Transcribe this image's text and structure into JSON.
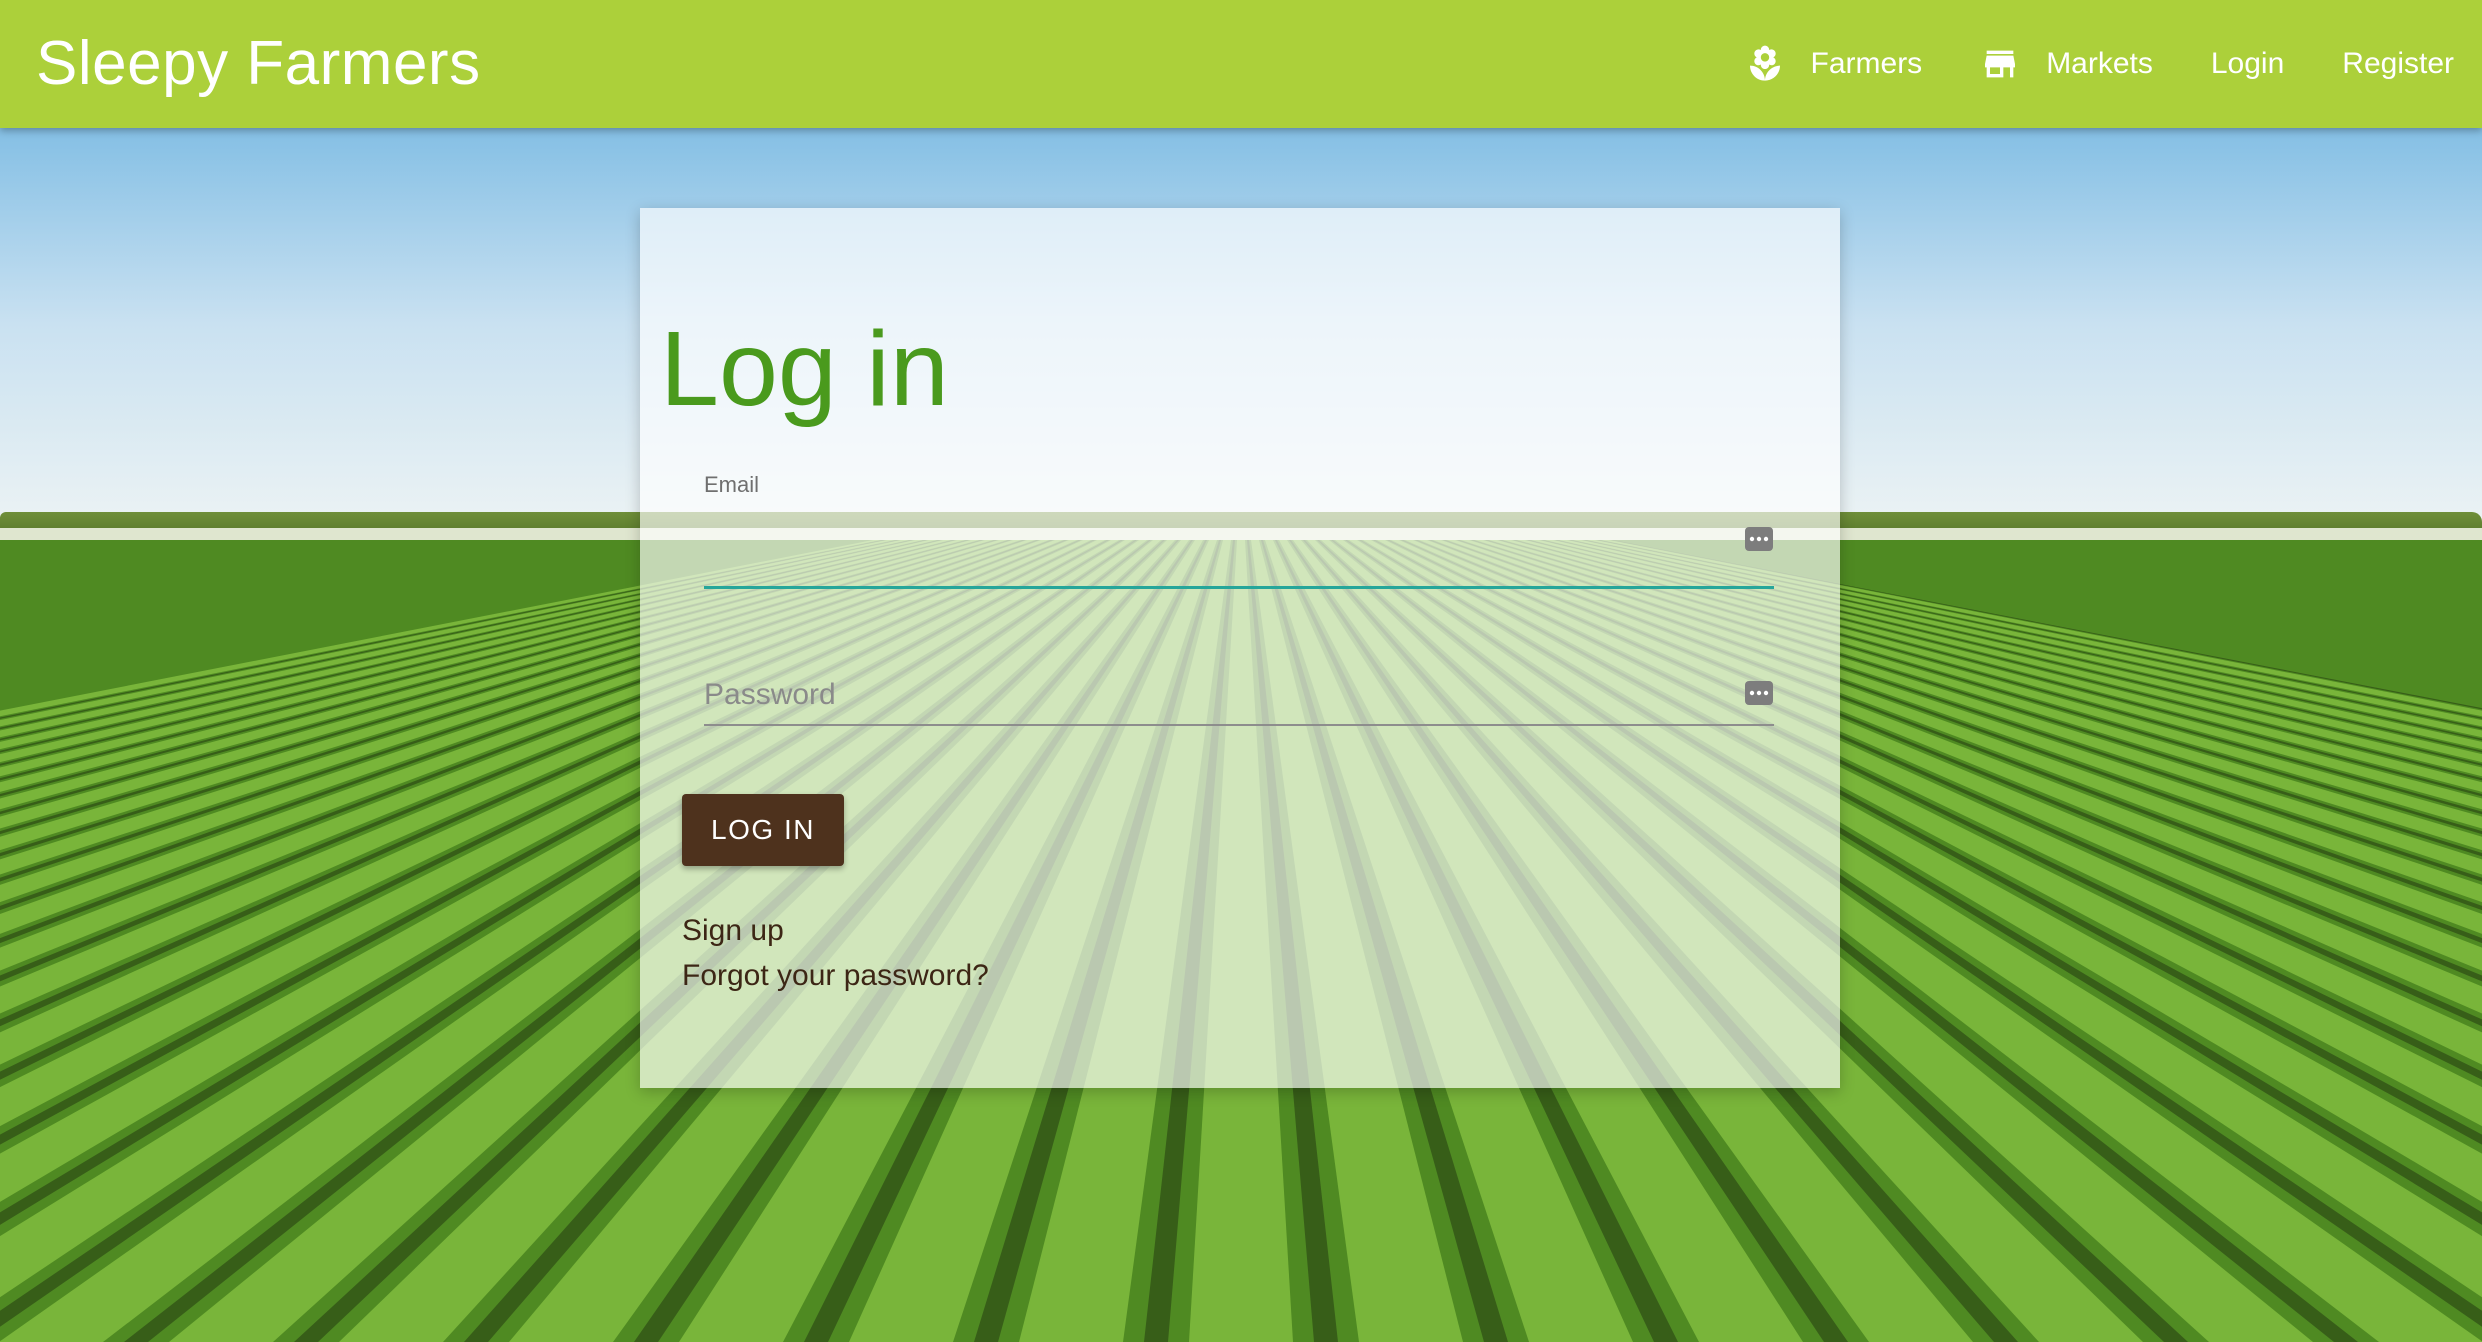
{
  "app": {
    "title": "Sleepy Farmers"
  },
  "nav": {
    "items": [
      {
        "label": "Farmers",
        "icon": "flower-icon"
      },
      {
        "label": "Markets",
        "icon": "storefront-icon"
      },
      {
        "label": "Login"
      },
      {
        "label": "Register"
      }
    ]
  },
  "login": {
    "title": "Log in",
    "email_label": "Email",
    "email_value": "",
    "password_placeholder": "Password",
    "password_value": "",
    "submit_label": "LOG IN",
    "signup_link": "Sign up",
    "forgot_link": "Forgot your password?"
  },
  "colors": {
    "navbar": "#acd03a",
    "title_green": "#4a9a1d",
    "button_brown": "#4e321d",
    "focus_teal": "#26a69a"
  }
}
